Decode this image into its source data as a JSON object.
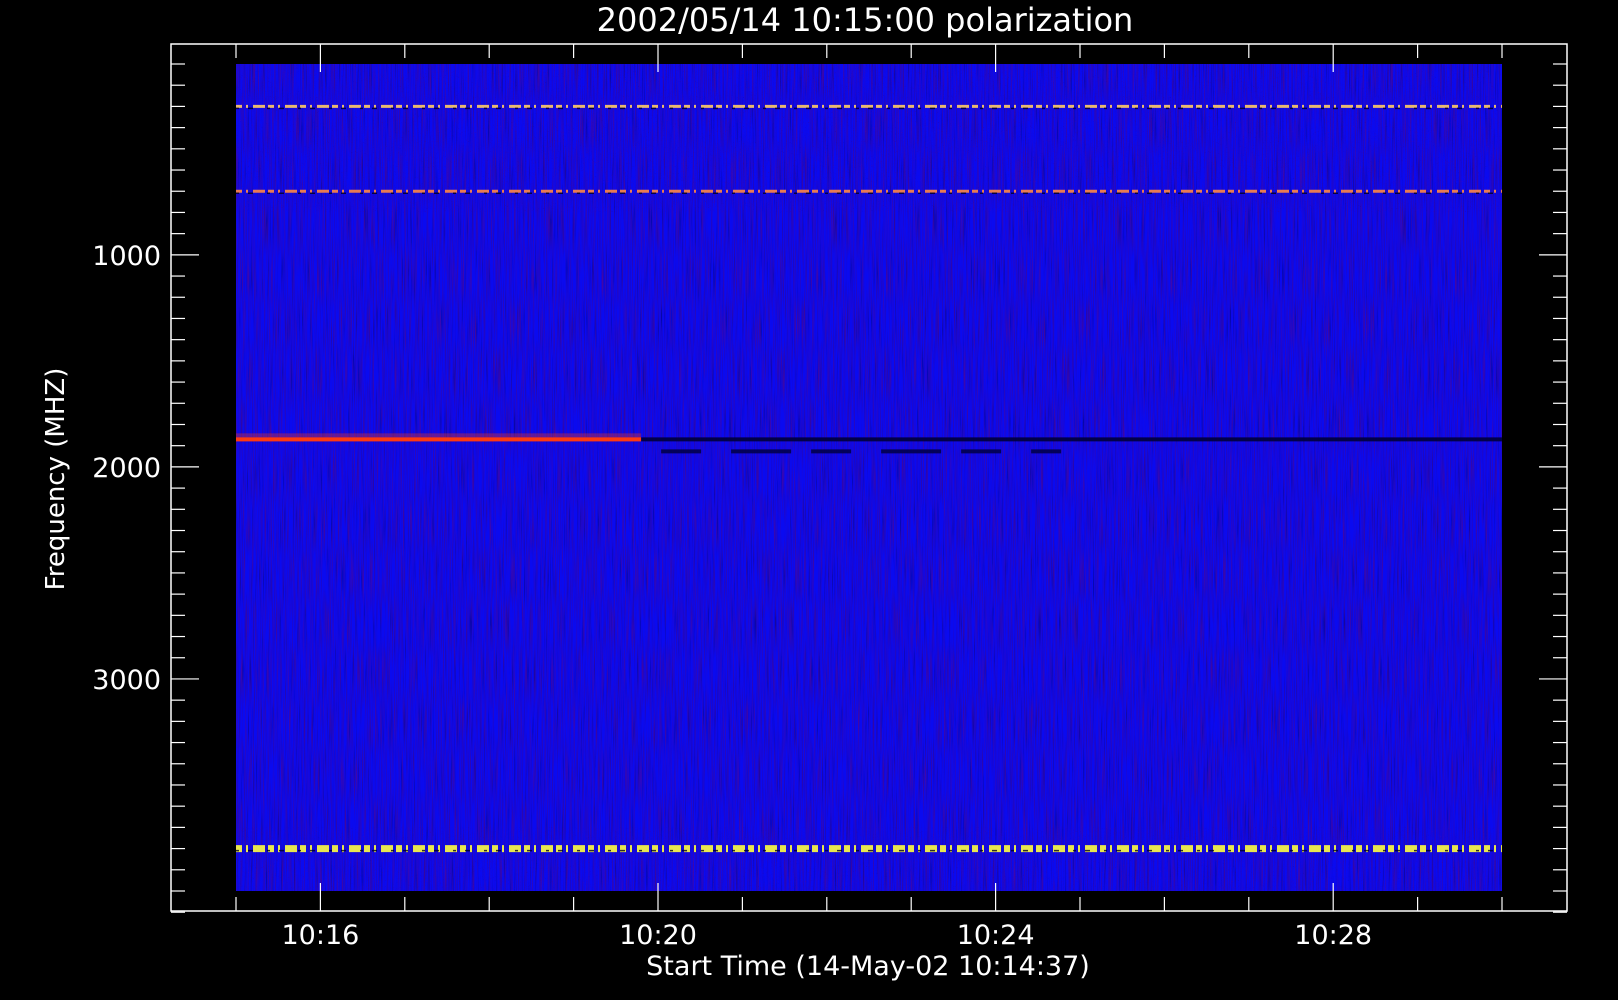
{
  "chart_data": {
    "type": "heatmap",
    "title": "2002/05/14 10:15:00 polarization",
    "xlabel": "Start Time (14-May-02 10:14:37)",
    "ylabel": "Frequency (MHZ)",
    "x_ticks": [
      "10:16",
      "10:20",
      "10:24",
      "10:28"
    ],
    "x_tick_minutes": [
      16,
      20,
      24,
      28
    ],
    "x_data_range_minutes": [
      15,
      30
    ],
    "y_ticks": [
      1000,
      2000,
      3000
    ],
    "y_data_range_mhz": [
      100,
      4000
    ],
    "y_axis_range_mhz": [
      0,
      4200
    ],
    "y_inverted": true,
    "grid": false,
    "colors": {
      "background": "#000000",
      "base": "#0a0af0",
      "axes": "#ffffff"
    },
    "features": [
      {
        "label": "emission",
        "freq_mhz": 1870,
        "t_start": 15.0,
        "t_end": 19.8,
        "color": "#ff3a10"
      },
      {
        "label": "absorption",
        "freq_mhz": 1870,
        "t_start": 19.8,
        "t_end": 30.0,
        "color": "#00003a"
      },
      {
        "label": "interference",
        "freq_mhz": 300,
        "t_start": 15.0,
        "t_end": 30.0,
        "color": "#ffcc66"
      },
      {
        "label": "interference",
        "freq_mhz": 700,
        "t_start": 15.0,
        "t_end": 30.0,
        "color": "#ff8844"
      },
      {
        "label": "interference",
        "freq_mhz": 3800,
        "t_start": 15.0,
        "t_end": 30.0,
        "color": "#ffff40"
      }
    ]
  }
}
